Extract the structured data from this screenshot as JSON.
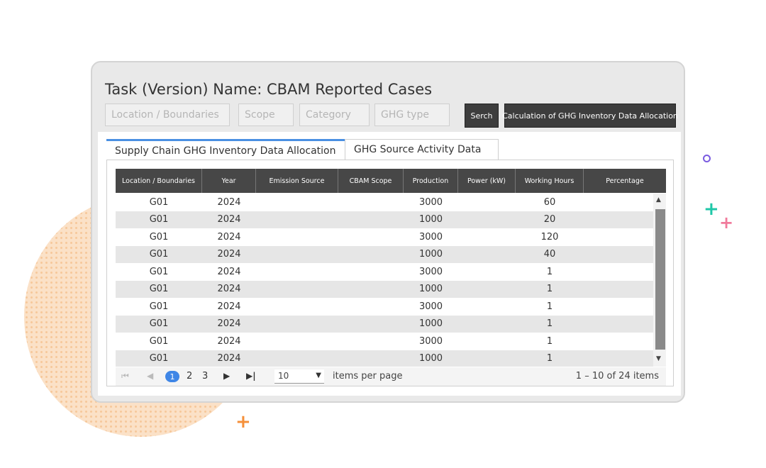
{
  "title": "Task (Version) Name: CBAM Reported Cases",
  "filters": {
    "location": "Location / Boundaries",
    "scope": "Scope",
    "category": "Category",
    "ghg_type": "GHG type"
  },
  "buttons": {
    "search": "Serch",
    "calculate": "Calculation of GHG Inventory Data Allocation"
  },
  "tabs": [
    {
      "label": "Supply Chain GHG Inventory Data Allocation",
      "active": true
    },
    {
      "label": "GHG Source Activity Data",
      "active": false
    }
  ],
  "table": {
    "columns": [
      "Location / Boundaries",
      "Year",
      "Emission Source",
      "CBAM Scope",
      "Production",
      "Power (kW)",
      "Working Hours",
      "Percentage"
    ],
    "rows": [
      [
        "G01",
        "2024",
        "",
        "",
        "3000",
        "",
        "60",
        ""
      ],
      [
        "G01",
        "2024",
        "",
        "",
        "1000",
        "",
        "20",
        ""
      ],
      [
        "G01",
        "2024",
        "",
        "",
        "3000",
        "",
        "120",
        ""
      ],
      [
        "G01",
        "2024",
        "",
        "",
        "1000",
        "",
        "40",
        ""
      ],
      [
        "G01",
        "2024",
        "",
        "",
        "3000",
        "",
        "1",
        ""
      ],
      [
        "G01",
        "2024",
        "",
        "",
        "1000",
        "",
        "1",
        ""
      ],
      [
        "G01",
        "2024",
        "",
        "",
        "3000",
        "",
        "1",
        ""
      ],
      [
        "G01",
        "2024",
        "",
        "",
        "1000",
        "",
        "1",
        ""
      ],
      [
        "G01",
        "2024",
        "",
        "",
        "3000",
        "",
        "1",
        ""
      ],
      [
        "G01",
        "2024",
        "",
        "",
        "1000",
        "",
        "1",
        ""
      ]
    ]
  },
  "pager": {
    "pages": [
      "1",
      "2",
      "3"
    ],
    "current": "1",
    "per_page": "10",
    "per_page_label": "items per page",
    "range": "1 – 10 of 24 items"
  },
  "icons": {
    "first": "⏮",
    "prev": "◀",
    "next": "▶",
    "last": "▶|",
    "caret": "▼",
    "scroll_up": "▲",
    "scroll_down": "▼",
    "plus": "+"
  },
  "colors": {
    "accent": "#4a90e2",
    "header_bg": "#474747",
    "plus_teal": "#1fc7a8",
    "plus_pink": "#f07a9b",
    "plus_orange": "#f5903a",
    "ring_purple": "#7a5be0"
  }
}
